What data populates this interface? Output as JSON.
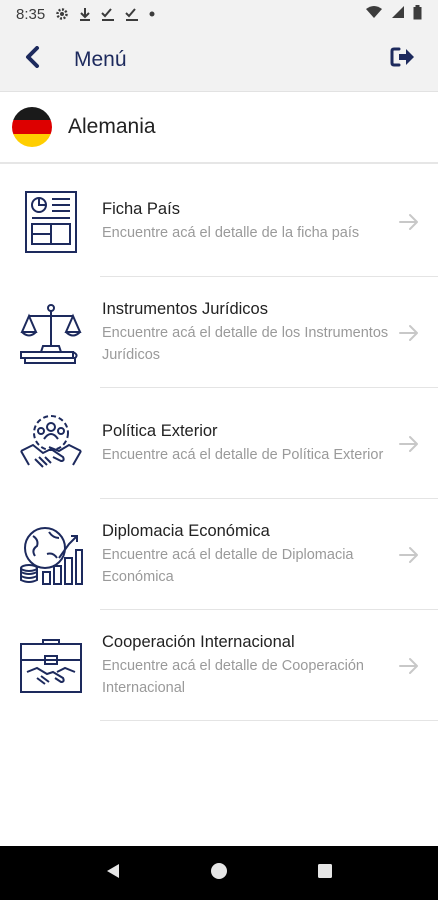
{
  "status_bar": {
    "time": "8:35"
  },
  "app_bar": {
    "title": "Menú"
  },
  "country": {
    "name": "Alemania",
    "flag_colors": [
      "#1a1a1a",
      "#dd0000",
      "#ffce00"
    ]
  },
  "colors": {
    "primary": "#1d2a5d",
    "arrow": "#c8c8c8"
  },
  "menu": {
    "items": [
      {
        "title": "Ficha País",
        "description": "Encuentre acá el detalle de la ficha país",
        "icon": "country-file-icon"
      },
      {
        "title": "Instrumentos Jurídicos",
        "description": "Encuentre acá el detalle de los Instrumentos Jurídicos",
        "icon": "scales-justice-icon"
      },
      {
        "title": "Política Exterior",
        "description": "Encuentre acá el detalle de Política Exterior",
        "icon": "handshake-people-icon"
      },
      {
        "title": "Diplomacia Económica",
        "description": "Encuentre acá el detalle de Diplomacia Económica",
        "icon": "globe-growth-chart-icon"
      },
      {
        "title": "Cooperación Internacional",
        "description": "Encuentre acá el detalle de Cooperación Internacional",
        "icon": "briefcase-handshake-icon"
      }
    ]
  }
}
